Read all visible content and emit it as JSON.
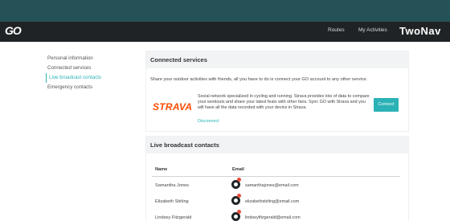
{
  "navbar": {
    "logo_text": "GO",
    "links": [
      "Routes",
      "My Activities"
    ],
    "brand": "TwoNav"
  },
  "sidebar": {
    "items": [
      {
        "label": "Personal information",
        "active": false
      },
      {
        "label": "Connected services",
        "active": false
      },
      {
        "label": "Live broadcast contacts",
        "active": true
      },
      {
        "label": "Emergency contacts",
        "active": false
      }
    ]
  },
  "connected_services": {
    "title": "Connected services",
    "intro": "Share your outdoor activities with friends, all you have to do is connect your GO account to any other service.",
    "service": {
      "name": "STRAVA",
      "description": "Social network specialized in cycling and running. Strava provides lots of data to compare your workouts and share your latest feats with other fans. Sync GO with Strava and you will have all the data recorded with your device in Strava.",
      "disconnect_label": "Disconnect",
      "connect_label": "Connect"
    }
  },
  "live_broadcast": {
    "title": "Live broadcast contacts",
    "columns": {
      "name": "Name",
      "email": "Email"
    },
    "rows": [
      {
        "name": "Samantha Jones",
        "email": "samanthajones@email.com"
      },
      {
        "name": "Elizabeth Stirling",
        "email": "elizabethstirling@email.com"
      },
      {
        "name": "Lindsey Fitzgerald",
        "email": "lindseyfitzgerald@email.com"
      }
    ]
  },
  "colors": {
    "accent": "#2ab2b6",
    "topbar": "#245257",
    "navbar": "#1f2325",
    "strava": "#fc4c02",
    "avatar_badge": "#e74c3c"
  }
}
